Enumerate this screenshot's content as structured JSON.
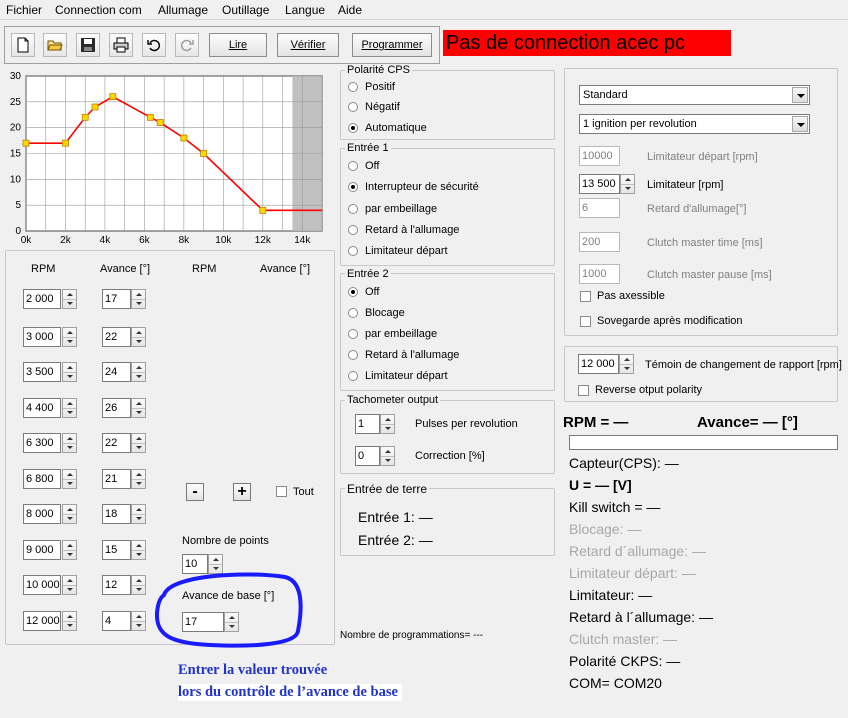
{
  "menu": [
    "Fichier",
    "Connection com",
    "Allumage",
    "Outillage",
    "Langue",
    "Aide"
  ],
  "toolbar": {
    "icons": [
      "new-file-icon",
      "open-folder-icon",
      "save-icon",
      "print-icon",
      "undo-icon",
      "redo-icon"
    ],
    "read_label": "Lire",
    "verify_label": "Vérifier",
    "program_label": "Programmer"
  },
  "banner": {
    "text": "Pas de connection acec pc",
    "color": "#ff0000"
  },
  "chart_data": {
    "type": "line",
    "x": [
      0,
      2000,
      3000,
      3500,
      4400,
      6300,
      6800,
      8000,
      9000,
      12000,
      15000
    ],
    "y": [
      17,
      17,
      22,
      24,
      26,
      22,
      21,
      18,
      15,
      4,
      4
    ],
    "markers_x": [
      0,
      2000,
      3000,
      3500,
      4400,
      6300,
      6800,
      8000,
      9000,
      12000
    ],
    "xlim": [
      0,
      15000
    ],
    "ylim": [
      0,
      30
    ],
    "x_ticks": [
      "0k",
      "2k",
      "4k",
      "6k",
      "8k",
      "10k",
      "12k",
      "14k"
    ],
    "y_ticks": [
      "0",
      "5",
      "10",
      "15",
      "20",
      "25",
      "30"
    ],
    "line_color": "#ff0000",
    "marker_color": "#ffd700",
    "shaded_from": 13500,
    "grid": true
  },
  "table": {
    "headers": [
      "RPM",
      "Avance [°]",
      "RPM",
      "Avance [°]"
    ],
    "rows": [
      {
        "rpm": "2 000",
        "adv": "17"
      },
      {
        "rpm": "3 000",
        "adv": "22"
      },
      {
        "rpm": "3 500",
        "adv": "24"
      },
      {
        "rpm": "4 400",
        "adv": "26"
      },
      {
        "rpm": "6 300",
        "adv": "22"
      },
      {
        "rpm": "6 800",
        "adv": "21"
      },
      {
        "rpm": "8 000",
        "adv": "18"
      },
      {
        "rpm": "9 000",
        "adv": "15"
      },
      {
        "rpm": "10 000",
        "adv": "12"
      },
      {
        "rpm": "12 000",
        "adv": "4"
      }
    ]
  },
  "controls": {
    "minus": "-",
    "plus": "+",
    "all_label": "Tout",
    "points_label": "Nombre de points",
    "points_value": "10",
    "base_label": "Avance de base [°]",
    "base_value": "17"
  },
  "polarity": {
    "title": "Polarité CPS",
    "options": [
      "Positif",
      "Négatif",
      "Automatique"
    ],
    "selected": 2
  },
  "entree1": {
    "title": "Entrée 1",
    "options": [
      "Off",
      "Interrupteur de sécurité",
      "par embeillage",
      "Retard à l'allumage",
      "Limitateur départ"
    ],
    "selected": 1
  },
  "entree2": {
    "title": "Entrée 2",
    "options": [
      "Off",
      "Blocage",
      "par embeillage",
      "Retard à l'allumage",
      "Limitateur départ"
    ],
    "selected": 0
  },
  "tacho": {
    "title": "Tachometer output",
    "pulses_value": "1",
    "pulses_label": "Pulses per revolution",
    "correction_value": "0",
    "correction_label": "Correction [%]"
  },
  "terre": {
    "title": "Entrée de terre",
    "e1": "Entrée 1: —",
    "e2": "Entrée 2: —"
  },
  "prog_count": "Nombre de programmations= ---",
  "settings": {
    "mode": "Standard",
    "ignition": "1 ignition per revolution",
    "fields": [
      {
        "value": "10000",
        "label": "Limitateur départ [rpm]",
        "enabled": false,
        "spin": false
      },
      {
        "value": "13 500",
        "label": "Limitateur [rpm]",
        "enabled": true,
        "spin": true
      },
      {
        "value": "6",
        "label": "Retard d'allumage[°]",
        "enabled": false,
        "spin": false
      },
      {
        "value": "200",
        "label": "Clutch master time [ms]",
        "enabled": false,
        "spin": false
      },
      {
        "value": "1000",
        "label": "Clutch master pause [ms]",
        "enabled": false,
        "spin": false
      }
    ],
    "pas_axessible": "Pas axessible",
    "sovegarde": "Sovegarde après modification"
  },
  "shift": {
    "value": "12 000",
    "label": "Témoin de changement de rapport [rpm]",
    "reverse": "Reverse otput polarity"
  },
  "live": {
    "rpm": "RPM = —",
    "avance": "Avance= — [°]",
    "capteur": "Capteur(CPS): —",
    "u": "U = — [V]",
    "kill": "Kill switch = —",
    "blocage": "Blocage: —",
    "retard1": "Retard d´allumage: —",
    "limitateur_depart": "Limitateur départ: —",
    "limitateur": "Limitateur: —",
    "retard2": "Retard à l´allumage: —",
    "clutch": "Clutch master: —",
    "polarite": "Polarité CKPS: —",
    "com": "COM= COM20"
  },
  "annotation": {
    "line1": "Entrer la valeur trouvée",
    "line2": "lors du contrôle de l’avance de base",
    "circle_color": "#1a1aff"
  }
}
